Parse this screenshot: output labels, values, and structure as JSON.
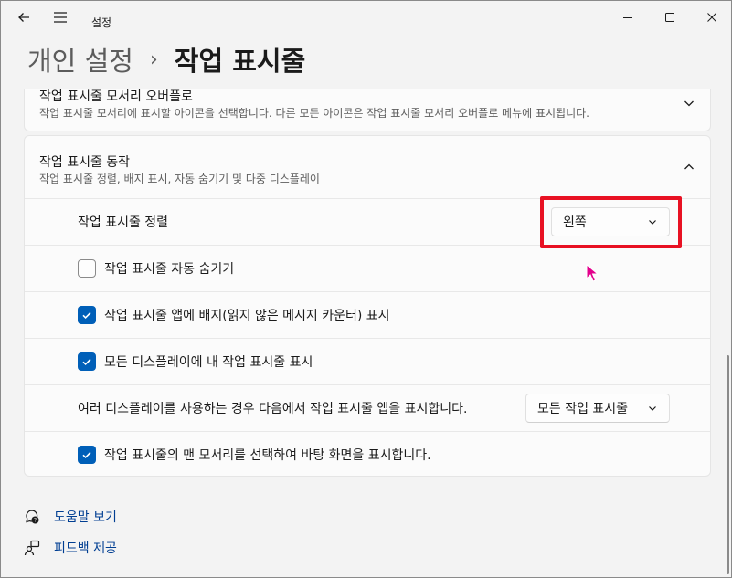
{
  "window": {
    "app_title": "설정"
  },
  "breadcrumb": {
    "parent": "개인 설정",
    "separator": "›",
    "current": "작업 표시줄"
  },
  "overflow_card": {
    "title": "작업 표시줄 모서리 오버플로",
    "description": "작업 표시줄 모서리에 표시할 아이콘을 선택합니다. 다른 모든 아이콘은 작업 표시줄 모서리 오버플로 메뉴에 표시됩니다."
  },
  "behavior_card": {
    "title": "작업 표시줄 동작",
    "description": "작업 표시줄 정렬, 배지 표시, 자동 숨기기 및 다중 디스플레이",
    "alignment": {
      "label": "작업 표시줄 정렬",
      "value": "왼쪽"
    },
    "options": [
      {
        "label": "작업 표시줄 자동 숨기기",
        "checked": false
      },
      {
        "label": "작업 표시줄 앱에 배지(읽지 않은 메시지 카운터) 표시",
        "checked": true
      },
      {
        "label": "모든 디스플레이에 내 작업 표시줄 표시",
        "checked": true
      }
    ],
    "multi_display": {
      "label": "여러 디스플레이를 사용하는 경우 다음에서 작업 표시줄 앱을 표시합니다.",
      "value": "모든 작업 표시줄"
    },
    "desktop_corner": {
      "label": "작업 표시줄의 맨 모서리를 선택하여 바탕 화면을 표시합니다.",
      "checked": true
    }
  },
  "footer": {
    "help_label": "도움말 보기",
    "feedback_label": "피드백 제공"
  },
  "colors": {
    "accent": "#005fb8",
    "highlight_box": "#e81123",
    "cursor": "#e3008c",
    "link": "#003e92"
  }
}
